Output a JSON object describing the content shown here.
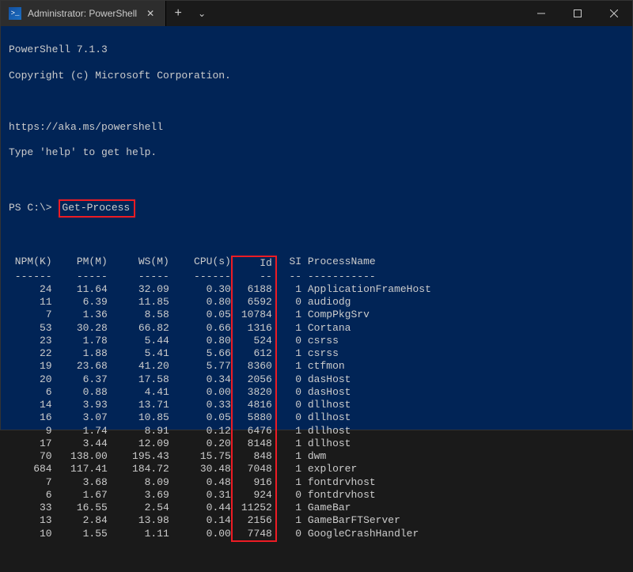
{
  "window": {
    "tab_title": "Administrator: PowerShell"
  },
  "banner": {
    "l1": "PowerShell 7.1.3",
    "l2": "Copyright (c) Microsoft Corporation.",
    "l3": "https://aka.ms/powershell",
    "l4": "Type 'help' to get help."
  },
  "prompt": {
    "ps": "PS C:\\>",
    "command": "Get-Process"
  },
  "headers": {
    "npm": "NPM(K)",
    "pm": "PM(M)",
    "ws": "WS(M)",
    "cpu": "CPU(s)",
    "id": "Id",
    "si": "SI",
    "name": "ProcessName"
  },
  "dashes": {
    "npm": "------",
    "pm": "-----",
    "ws": "-----",
    "cpu": "------",
    "id": "--",
    "si": "--",
    "name": "-----------"
  },
  "rows": [
    {
      "npm": "24",
      "pm": "11.64",
      "ws": "32.09",
      "cpu": "0.30",
      "id": "6188",
      "si": "1",
      "name": "ApplicationFrameHost"
    },
    {
      "npm": "11",
      "pm": "6.39",
      "ws": "11.85",
      "cpu": "0.80",
      "id": "6592",
      "si": "0",
      "name": "audiodg"
    },
    {
      "npm": "7",
      "pm": "1.36",
      "ws": "8.58",
      "cpu": "0.05",
      "id": "10784",
      "si": "1",
      "name": "CompPkgSrv"
    },
    {
      "npm": "53",
      "pm": "30.28",
      "ws": "66.82",
      "cpu": "0.66",
      "id": "1316",
      "si": "1",
      "name": "Cortana"
    },
    {
      "npm": "23",
      "pm": "1.78",
      "ws": "5.44",
      "cpu": "0.80",
      "id": "524",
      "si": "0",
      "name": "csrss"
    },
    {
      "npm": "22",
      "pm": "1.88",
      "ws": "5.41",
      "cpu": "5.66",
      "id": "612",
      "si": "1",
      "name": "csrss"
    },
    {
      "npm": "19",
      "pm": "23.68",
      "ws": "41.20",
      "cpu": "5.77",
      "id": "8360",
      "si": "1",
      "name": "ctfmon"
    },
    {
      "npm": "20",
      "pm": "6.37",
      "ws": "17.58",
      "cpu": "0.34",
      "id": "2056",
      "si": "0",
      "name": "dasHost"
    },
    {
      "npm": "6",
      "pm": "0.88",
      "ws": "4.41",
      "cpu": "0.00",
      "id": "3820",
      "si": "0",
      "name": "dasHost"
    },
    {
      "npm": "14",
      "pm": "3.93",
      "ws": "13.71",
      "cpu": "0.33",
      "id": "4816",
      "si": "0",
      "name": "dllhost"
    },
    {
      "npm": "16",
      "pm": "3.07",
      "ws": "10.85",
      "cpu": "0.05",
      "id": "5880",
      "si": "0",
      "name": "dllhost"
    },
    {
      "npm": "9",
      "pm": "1.74",
      "ws": "8.91",
      "cpu": "0.12",
      "id": "6476",
      "si": "1",
      "name": "dllhost"
    },
    {
      "npm": "17",
      "pm": "3.44",
      "ws": "12.09",
      "cpu": "0.20",
      "id": "8148",
      "si": "1",
      "name": "dllhost"
    },
    {
      "npm": "70",
      "pm": "138.00",
      "ws": "195.43",
      "cpu": "15.75",
      "id": "848",
      "si": "1",
      "name": "dwm"
    },
    {
      "npm": "684",
      "pm": "117.41",
      "ws": "184.72",
      "cpu": "30.48",
      "id": "7048",
      "si": "1",
      "name": "explorer"
    },
    {
      "npm": "7",
      "pm": "3.68",
      "ws": "8.09",
      "cpu": "0.48",
      "id": "916",
      "si": "1",
      "name": "fontdrvhost"
    },
    {
      "npm": "6",
      "pm": "1.67",
      "ws": "3.69",
      "cpu": "0.31",
      "id": "924",
      "si": "0",
      "name": "fontdrvhost"
    },
    {
      "npm": "33",
      "pm": "16.55",
      "ws": "2.54",
      "cpu": "0.44",
      "id": "11252",
      "si": "1",
      "name": "GameBar"
    },
    {
      "npm": "13",
      "pm": "2.84",
      "ws": "13.98",
      "cpu": "0.14",
      "id": "2156",
      "si": "1",
      "name": "GameBarFTServer"
    },
    {
      "npm": "10",
      "pm": "1.55",
      "ws": "1.11",
      "cpu": "0.00",
      "id": "7748",
      "si": "0",
      "name": "GoogleCrashHandler"
    }
  ]
}
